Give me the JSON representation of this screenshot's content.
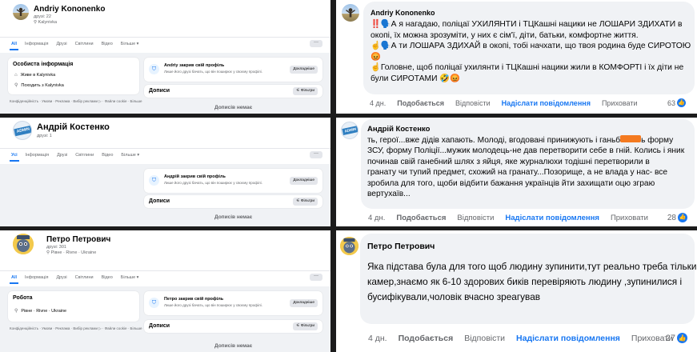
{
  "profiles": [
    {
      "name": "Andriy Kononenko",
      "friends": "друзі: 22",
      "location": "Kalynivka",
      "tabs": [
        "All",
        "Інформація",
        "Друзі",
        "Світлини",
        "Відео",
        "Більше ▾"
      ],
      "more": "···",
      "info_title": "Особиста інформація",
      "info_rows": [
        "Живе в Kalynivka",
        "Походить з Kalynivka"
      ],
      "locked_title": "Andriy закрив свій профіль",
      "locked_sub": "Лише його друзі бачать, що він поширює у своєму профілі.",
      "details_btn": "Докладніше",
      "posts": "Дописи",
      "filters": "Фільтри",
      "footer": "Конфіденційність · Умови · Реклама · Вибір реклами ▷ · Файли cookie · Більше",
      "no_posts": "Дописів немає"
    },
    {
      "name": "Андрій Костенко",
      "friends": "друзі: 1",
      "avatar_text": "ADMIN",
      "tabs": [
        "Усі",
        "Інформація",
        "Друзі",
        "Світлини",
        "Відео",
        "Більше ▾"
      ],
      "more": "···",
      "locked_title": "Андрій закрив свій профіль",
      "locked_sub": "Лише його друзі бачать, що він поширює у своєму профілі.",
      "details_btn": "Докладніше",
      "posts": "Дописи",
      "filters": "Фільтри",
      "no_posts": "Дописів немає"
    },
    {
      "name": "Петро Петрович",
      "friends": "друзі: 301",
      "location": "Рівне · Rivne · Ukraine",
      "tabs": [
        "All",
        "Інформація",
        "Друзі",
        "Світлини",
        "Відео",
        "Більше ▾"
      ],
      "more": "···",
      "info_title": "Робота",
      "info_rows": [
        "Рівне · Rivne · Ukraine"
      ],
      "locked_title": "Петро закрив свій профіль",
      "locked_sub": "Лише його друзі бачать, що він поширює у своєму профілі.",
      "details_btn": "Докладніше",
      "posts": "Дописи",
      "filters": "Фільтри",
      "footer": "Конфіденційність · Умови · Реклама · Вибір реклами ▷ · Файли cookie · Більше",
      "no_posts": "Дописів немає"
    }
  ],
  "comments": [
    {
      "author": "Andriy Kononenko",
      "lines": [
        "‼️🗣️А я нагадаю, поліцаї УХИЛЯНТИ і ТЦКашні нацики не ЛОШАРИ ЗДИХАТИ в",
        "окопі, їх можна зрозуміти, у них є сім'ї, діти, батьки, комфортне життя.",
        "☝️🗣️А ти ЛОШАРА ЗДИХАЙ в окопі, тобі начхати, що твоя родина буде СИРОТОЮ",
        "😡",
        "☝️Головне, щоб поліцаї ухилянти і ТЦКашні нацики жили в КОМФОРТІ і їх діти не",
        "були СИРОТАМИ 🤣😡"
      ],
      "time": "4 дн.",
      "like": "Подобається",
      "reply": "Відповісти",
      "message": "Надіслати повідомлення",
      "hide": "Приховати",
      "count": "63"
    },
    {
      "author": "Андрій Костенко",
      "avatar_text": "ADMIN",
      "lines": [
        "ть, герої...вже дідів хапають. Молоді, вгодовані принижують і ганьб",
        "ЗСУ, форму Поліції...мужик молодець-не дав перетворити себе в гній. Колись і яник",
        "починав свій ганебний шлях з яйця, яке журналюхи тодішні перетворили в",
        "гранату чи тупий предмет, схожий на гранату...Позорище, а не влада у нас- все",
        "зробила для того, щоби відбити бажання українців йти захищати оцю зграю",
        "вертухаїв..."
      ],
      "line1_tail": "ь форму",
      "time": "4 дн.",
      "like": "Подобається",
      "reply": "Відповісти",
      "message": "Надіслати повідомлення",
      "hide": "Приховати",
      "count": "28"
    },
    {
      "author": "Петро Петрович",
      "lines": [
        "Яка підстава була для того щоб людину зупинити,тут реально треба тільки відео з",
        "камер,знаємо як 6-10 здорових биків перевіряють людину ,зупинилися і",
        "бусифікували,чоловік вчасно зреагував"
      ],
      "time": "4 дн.",
      "like": "Подобається",
      "reply": "Відповісти",
      "message": "Надіслати повідомлення",
      "hide": "Приховати",
      "count": "27"
    }
  ],
  "colors": {
    "accent": "#1877f2",
    "bubble": "#f0f2f5",
    "secondary": "#65676b",
    "redaction": "#f47a20"
  }
}
